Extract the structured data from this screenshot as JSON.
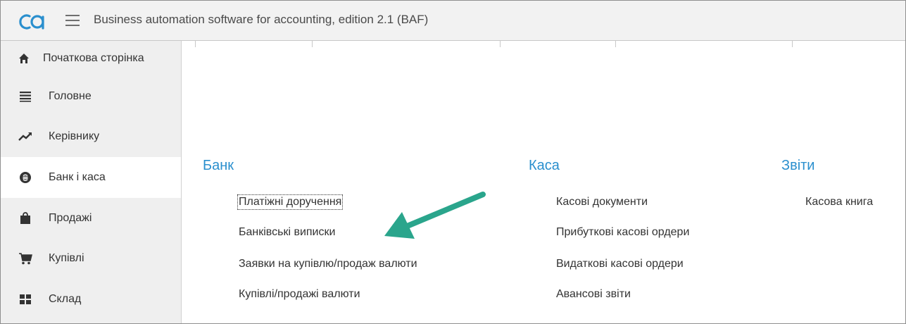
{
  "header": {
    "title": "Business automation software for accounting, edition 2.1  (BAF)",
    "logo_icon": "baf-logo-icon",
    "menu_icon": "hamburger-icon"
  },
  "sidebar": {
    "items": [
      {
        "label": "Початкова сторінка",
        "icon": "home-icon"
      },
      {
        "label": "Головне",
        "icon": "list-icon"
      },
      {
        "label": "Керівнику",
        "icon": "trend-icon"
      },
      {
        "label": "Банк і каса",
        "icon": "currency-icon",
        "active": true
      },
      {
        "label": "Продажі",
        "icon": "shopping-bag-icon"
      },
      {
        "label": "Купівлі",
        "icon": "cart-icon"
      },
      {
        "label": "Склад",
        "icon": "warehouse-icon"
      }
    ]
  },
  "sections": [
    {
      "title": "Банк",
      "links": [
        "Платіжні доручення",
        "Банківські виписки",
        "Заявки на купівлю/продаж валюти",
        "Купівлі/продажі валюти"
      ]
    },
    {
      "title": "Каса",
      "links": [
        "Касові документи",
        "Прибуткові касові ордери",
        "Видаткові касові ордери",
        "Авансові звіти"
      ]
    },
    {
      "title": "Звіти",
      "links": [
        "Касова книга"
      ]
    }
  ],
  "colors": {
    "accent": "#2a8fce",
    "arrow": "#2aa58c",
    "sidebar_bg": "#efefef",
    "header_bg": "#f2f2f2"
  }
}
